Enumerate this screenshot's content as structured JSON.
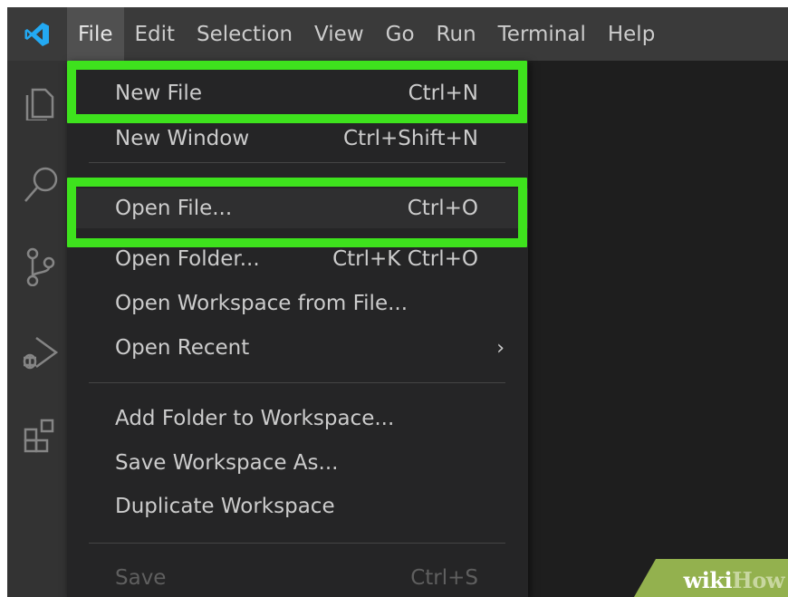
{
  "menubar": {
    "items": [
      "File",
      "Edit",
      "Selection",
      "View",
      "Go",
      "Run",
      "Terminal",
      "Help"
    ]
  },
  "activity_bar": {
    "icons": [
      "explorer-icon",
      "search-icon",
      "source-control-icon",
      "run-debug-icon",
      "extensions-icon"
    ]
  },
  "file_menu": {
    "new_file": {
      "label": "New File",
      "shortcut": "Ctrl+N"
    },
    "new_window": {
      "label": "New Window",
      "shortcut": "Ctrl+Shift+N"
    },
    "open_file": {
      "label": "Open File...",
      "shortcut": "Ctrl+O"
    },
    "open_folder": {
      "label": "Open Folder...",
      "shortcut": "Ctrl+K Ctrl+O"
    },
    "open_workspace": {
      "label": "Open Workspace from File..."
    },
    "open_recent": {
      "label": "Open Recent",
      "arrow": "›"
    },
    "add_folder": {
      "label": "Add Folder to Workspace..."
    },
    "save_workspace_as": {
      "label": "Save Workspace As..."
    },
    "duplicate_workspace": {
      "label": "Duplicate Workspace"
    },
    "save": {
      "label": "Save",
      "shortcut": "Ctrl+S"
    }
  },
  "colors": {
    "highlight_box": "#3ee21d",
    "menu_bg": "#252526",
    "menubar_bg": "#3a3a3a",
    "vscode_blue": "#23a9f2"
  },
  "watermark": {
    "wiki": "wiki",
    "how": "How"
  }
}
